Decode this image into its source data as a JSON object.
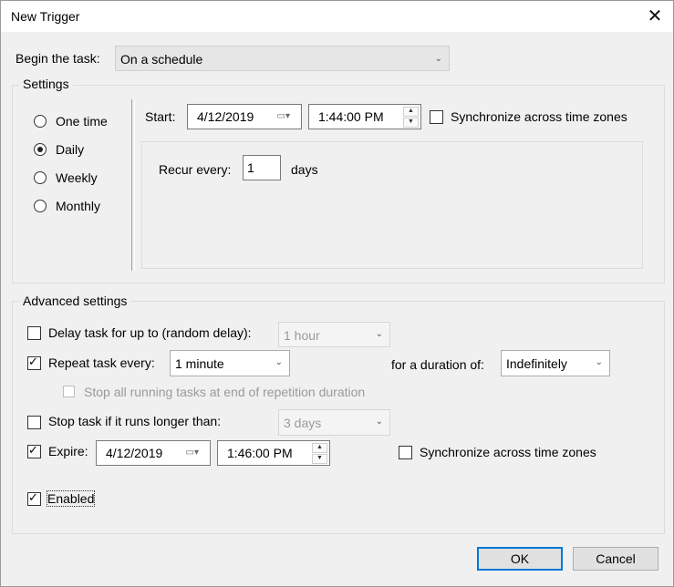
{
  "window": {
    "title": "New Trigger"
  },
  "begin": {
    "label": "Begin the task:",
    "value": "On a schedule"
  },
  "settings": {
    "legend": "Settings",
    "radios": [
      {
        "label": "One time",
        "checked": false
      },
      {
        "label": "Daily",
        "checked": true
      },
      {
        "label": "Weekly",
        "checked": false
      },
      {
        "label": "Monthly",
        "checked": false
      }
    ],
    "start_label": "Start:",
    "start_date": "4/12/2019",
    "start_time": "1:44:00 PM",
    "sync_label": "Synchronize across time zones",
    "recur_label": "Recur every:",
    "recur_value": "1",
    "recur_unit": "days"
  },
  "advanced": {
    "legend": "Advanced settings",
    "delay_label": "Delay task for up to (random delay):",
    "delay_value": "1 hour",
    "repeat_label": "Repeat task every:",
    "repeat_value": "1 minute",
    "duration_label": "for a duration of:",
    "duration_value": "Indefinitely",
    "stop_all_label": "Stop all running tasks at end of repetition duration",
    "stop_longer_label": "Stop task if it runs longer than:",
    "stop_longer_value": "3 days",
    "expire_label": "Expire:",
    "expire_date": "4/12/2019",
    "expire_time": "1:46:00 PM",
    "expire_sync_label": "Synchronize across time zones",
    "enabled_label": "Enabled"
  },
  "buttons": {
    "ok": "OK",
    "cancel": "Cancel"
  },
  "icons": {
    "close": "close-icon",
    "dropdown": "chevron-down-icon",
    "calendar": "calendar-icon",
    "spin": "spin-arrows-icon"
  }
}
